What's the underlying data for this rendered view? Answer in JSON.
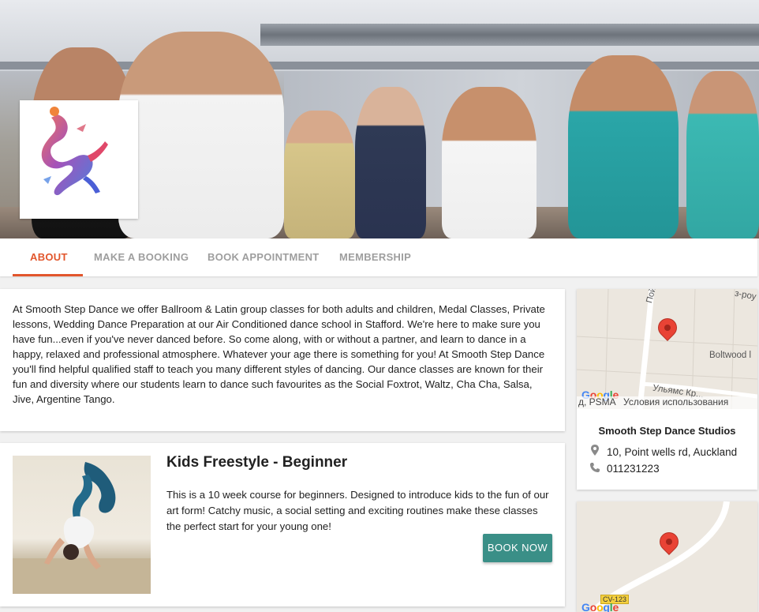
{
  "hero": {
    "image_alt": "Group of adults dancing in a studio",
    "logo_alt": "Smooth Step Dance logo"
  },
  "tabs": [
    {
      "label": "ABOUT",
      "active": true
    },
    {
      "label": "MAKE A BOOKING",
      "active": false
    },
    {
      "label": "BOOK APPOINTMENT",
      "active": false
    },
    {
      "label": "MEMBERSHIP",
      "active": false
    }
  ],
  "about": {
    "text": "At Smooth Step Dance we offer Ballroom & Latin group classes for both adults and children, Medal Classes, Private lessons, Wedding Dance Preparation at our Air Conditioned dance school in Stafford. We're here to make sure you have fun...even if you've never danced before. So come along, with or without a partner, and learn to dance in a happy, relaxed and professional atmosphere. Whatever your age there is something for you! At Smooth Step Dance you'll find helpful qualified staff to teach you many different styles of dancing. Our dance classes are known for their fun and diversity where our students learn to dance such favourites as the Social Foxtrot, Waltz, Cha Cha, Salsa, Jive, Argentine Tango."
  },
  "class_card": {
    "title": "Kids Freestyle - Beginner",
    "description": "This is a 10 week course for beginners. Designed to introduce kids to the fun of our art form! Catchy music, a social setting and exciting routines make these classes the perfect start for your young one!",
    "button_label": "BOOK NOW",
    "button_color": "#3a8f87"
  },
  "location": {
    "map_labels": {
      "street1": "Пойма Уэлс-...",
      "street2": "Boltwood l",
      "street3": "Ульямс Кр...",
      "street4": "з-роу",
      "footer_left": "д, PSMA",
      "footer_right": "Условия использования",
      "google": "Google"
    },
    "studio_name": "Smooth Step Dance Studios",
    "address": "10, Point wells rd, Auckland",
    "phone": "011231223",
    "address_icon": "map-pin-icon",
    "phone_icon": "phone-icon"
  },
  "map2": {
    "road_label": "CV-123",
    "google": "Google"
  },
  "colors": {
    "accent": "#e2562c",
    "tab_inactive": "#9e9e9e",
    "pin": "#e94335"
  }
}
